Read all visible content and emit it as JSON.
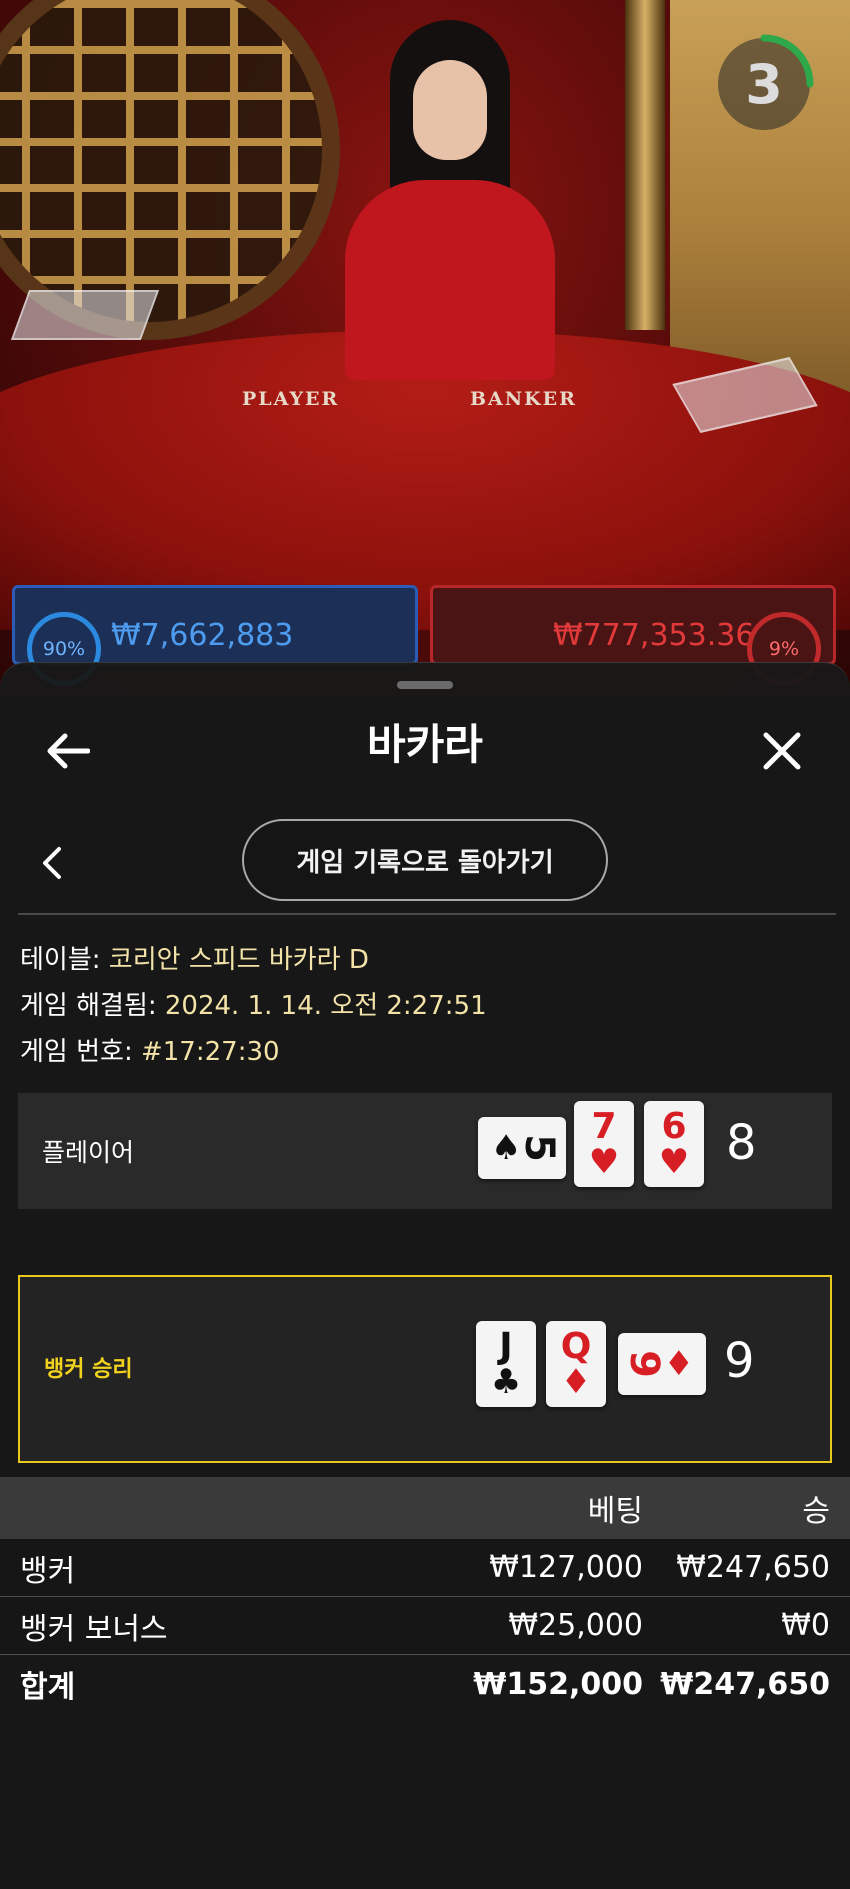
{
  "video": {
    "timer_value": "3",
    "player_felt_label": "PLAYER",
    "banker_felt_label": "BANKER",
    "player_strip": {
      "percent": "90%",
      "amount": "₩7,662,883"
    },
    "banker_strip": {
      "amount": "₩777,353.36",
      "percent": "9%"
    }
  },
  "sheet": {
    "title": "바카라",
    "back_to_history_label": "게임 기록으로 돌아가기",
    "meta": [
      {
        "label": "테이블: ",
        "value": "코리안 스피드 바카라 D"
      },
      {
        "label": "게임 해결됨: ",
        "value": "2024. 1. 14. 오전 2:27:51"
      },
      {
        "label": "게임 번호: ",
        "value": "#17:27:30"
      }
    ],
    "player_hand": {
      "label": "플레이어",
      "score": "8",
      "cards": [
        {
          "rank": "5",
          "suit": "♠",
          "color": "black"
        },
        {
          "rank": "7",
          "suit": "♥",
          "color": "red"
        },
        {
          "rank": "6",
          "suit": "♥",
          "color": "red"
        }
      ]
    },
    "banker_hand": {
      "label": "뱅커 승리",
      "score": "9",
      "cards": [
        {
          "rank": "J",
          "suit": "♣",
          "color": "black"
        },
        {
          "rank": "Q",
          "suit": "♦",
          "color": "red"
        },
        {
          "rank": "9",
          "suit": "♦",
          "color": "red"
        }
      ]
    },
    "bets_table": {
      "headers": {
        "bet": "베팅",
        "win": "승"
      },
      "rows": [
        {
          "name": "뱅커",
          "bet": "₩127,000",
          "win": "₩247,650"
        },
        {
          "name": "뱅커 보너스",
          "bet": "₩25,000",
          "win": "₩0"
        }
      ],
      "total": {
        "name": "합계",
        "bet": "₩152,000",
        "win": "₩247,650"
      }
    },
    "colors": {
      "accent_win": "#e8c81a",
      "player_blue": "#2b5cb8",
      "banker_red": "#b8282b"
    }
  }
}
